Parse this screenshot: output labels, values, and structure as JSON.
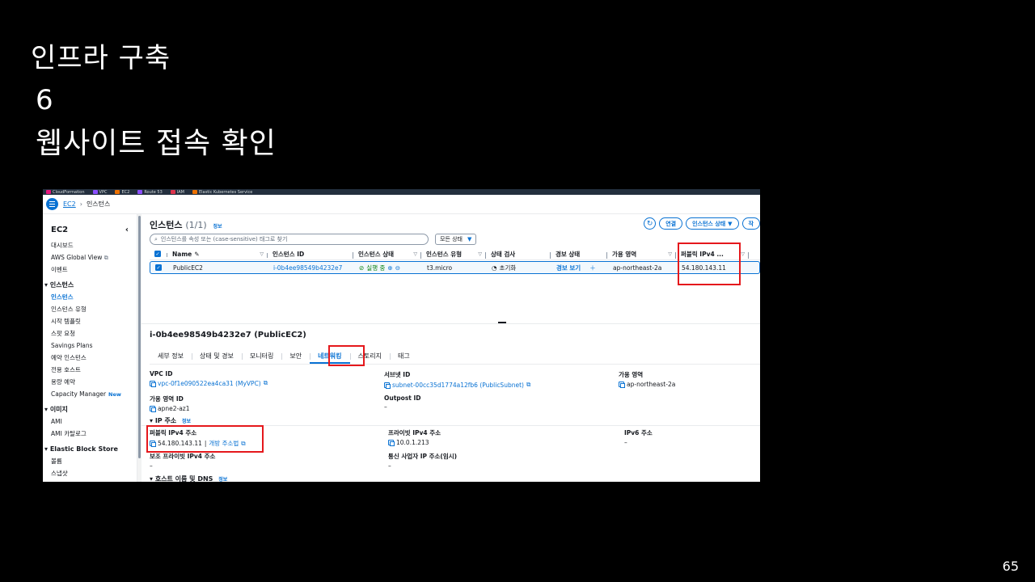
{
  "slide": {
    "title": "인프라 구축",
    "number": "6",
    "subtitle": "웹사이트 접속 확인",
    "page": "65"
  },
  "bookmarks": [
    {
      "label": "CloudFormation",
      "color": "#e7157b"
    },
    {
      "label": "VPC",
      "color": "#8c4fff"
    },
    {
      "label": "EC2",
      "color": "#ed7100"
    },
    {
      "label": "Route 53",
      "color": "#8c4fff"
    },
    {
      "label": "IAM",
      "color": "#dd344c"
    },
    {
      "label": "Elastic Kubernetes Service",
      "color": "#ed7100"
    }
  ],
  "breadcrumb": {
    "service": "EC2",
    "page": "인스턴스"
  },
  "sidebar": {
    "title": "EC2",
    "top_items": [
      "대시보드",
      "AWS Global View",
      "이벤트"
    ],
    "section_instances": "인스턴스",
    "instance_items": [
      "인스턴스",
      "인스턴스 유형",
      "시작 템플릿",
      "스팟 요청",
      "Savings Plans",
      "예약 인스턴스",
      "전용 호스트",
      "용량 예약",
      "Capacity Manager"
    ],
    "new_badge": "New",
    "section_images": "이미지",
    "image_items": [
      "AMI",
      "AMI 카탈로그"
    ],
    "section_ebs": "Elastic Block Store",
    "ebs_items": [
      "볼륨",
      "스냅샷"
    ]
  },
  "instances": {
    "title": "인스턴스",
    "count": "(1/1)",
    "info": "정보",
    "connect_label": "연결",
    "state_label": "인스턴스 상태",
    "extra_label": "작",
    "search_placeholder": "인스턴스를 속성 또는 (case-sensitive) 태그로 찾기",
    "filter_label": "모든 상태",
    "columns": [
      "Name",
      "인스턴스 ID",
      "인스턴스 상태",
      "인스턴스 유형",
      "상태 검사",
      "경보 상태",
      "가용 영역",
      "퍼블릭 IPv4 ..."
    ],
    "row": {
      "name": "PublicEC2",
      "id": "i-0b4ee98549b4232e7",
      "state": "실행 중",
      "type": "t3.micro",
      "check": "초기화",
      "alarm": "경보 보기",
      "zone": "ap-northeast-2a",
      "public_ip": "54.180.143.11"
    }
  },
  "details": {
    "title": "i-0b4ee98549b4232e7 (PublicEC2)",
    "tabs": [
      "세부 정보",
      "상태 및 경보",
      "모니터링",
      "보안",
      "네트워킹",
      "스토리지",
      "태그"
    ],
    "vpc_label": "VPC ID",
    "vpc_value": "vpc-0f1e090522ea4ca31 (MyVPC)",
    "subnet_label": "서브넷 ID",
    "subnet_value": "subnet-00cc35d1774a12fb6 (PublicSubnet)",
    "az_label": "가용 영역",
    "az_value": "ap-northeast-2a",
    "azid_label": "가용 영역 ID",
    "azid_value": "apne2-az1",
    "outpost_label": "Outpost ID",
    "outpost_value": "–",
    "ip_section": "IP 주소",
    "ip_info": "정보",
    "public_ip_label": "퍼블릭 IPv4 주소",
    "public_ip_value": "54.180.143.11",
    "open_address": "개방 주소법",
    "private_ip_label": "프라이빗 IPv4 주소",
    "private_ip_value": "10.0.1.213",
    "ipv6_label": "IPv6 주소",
    "ipv6_value": "–",
    "secondary_label": "보조 프라이빗 IPv4 주소",
    "secondary_value": "–",
    "carrier_label": "통신 사업자 IP 주소(임시)",
    "carrier_value": "–",
    "host_section": "호스트 이름 및 DNS",
    "host_info": "정보"
  }
}
